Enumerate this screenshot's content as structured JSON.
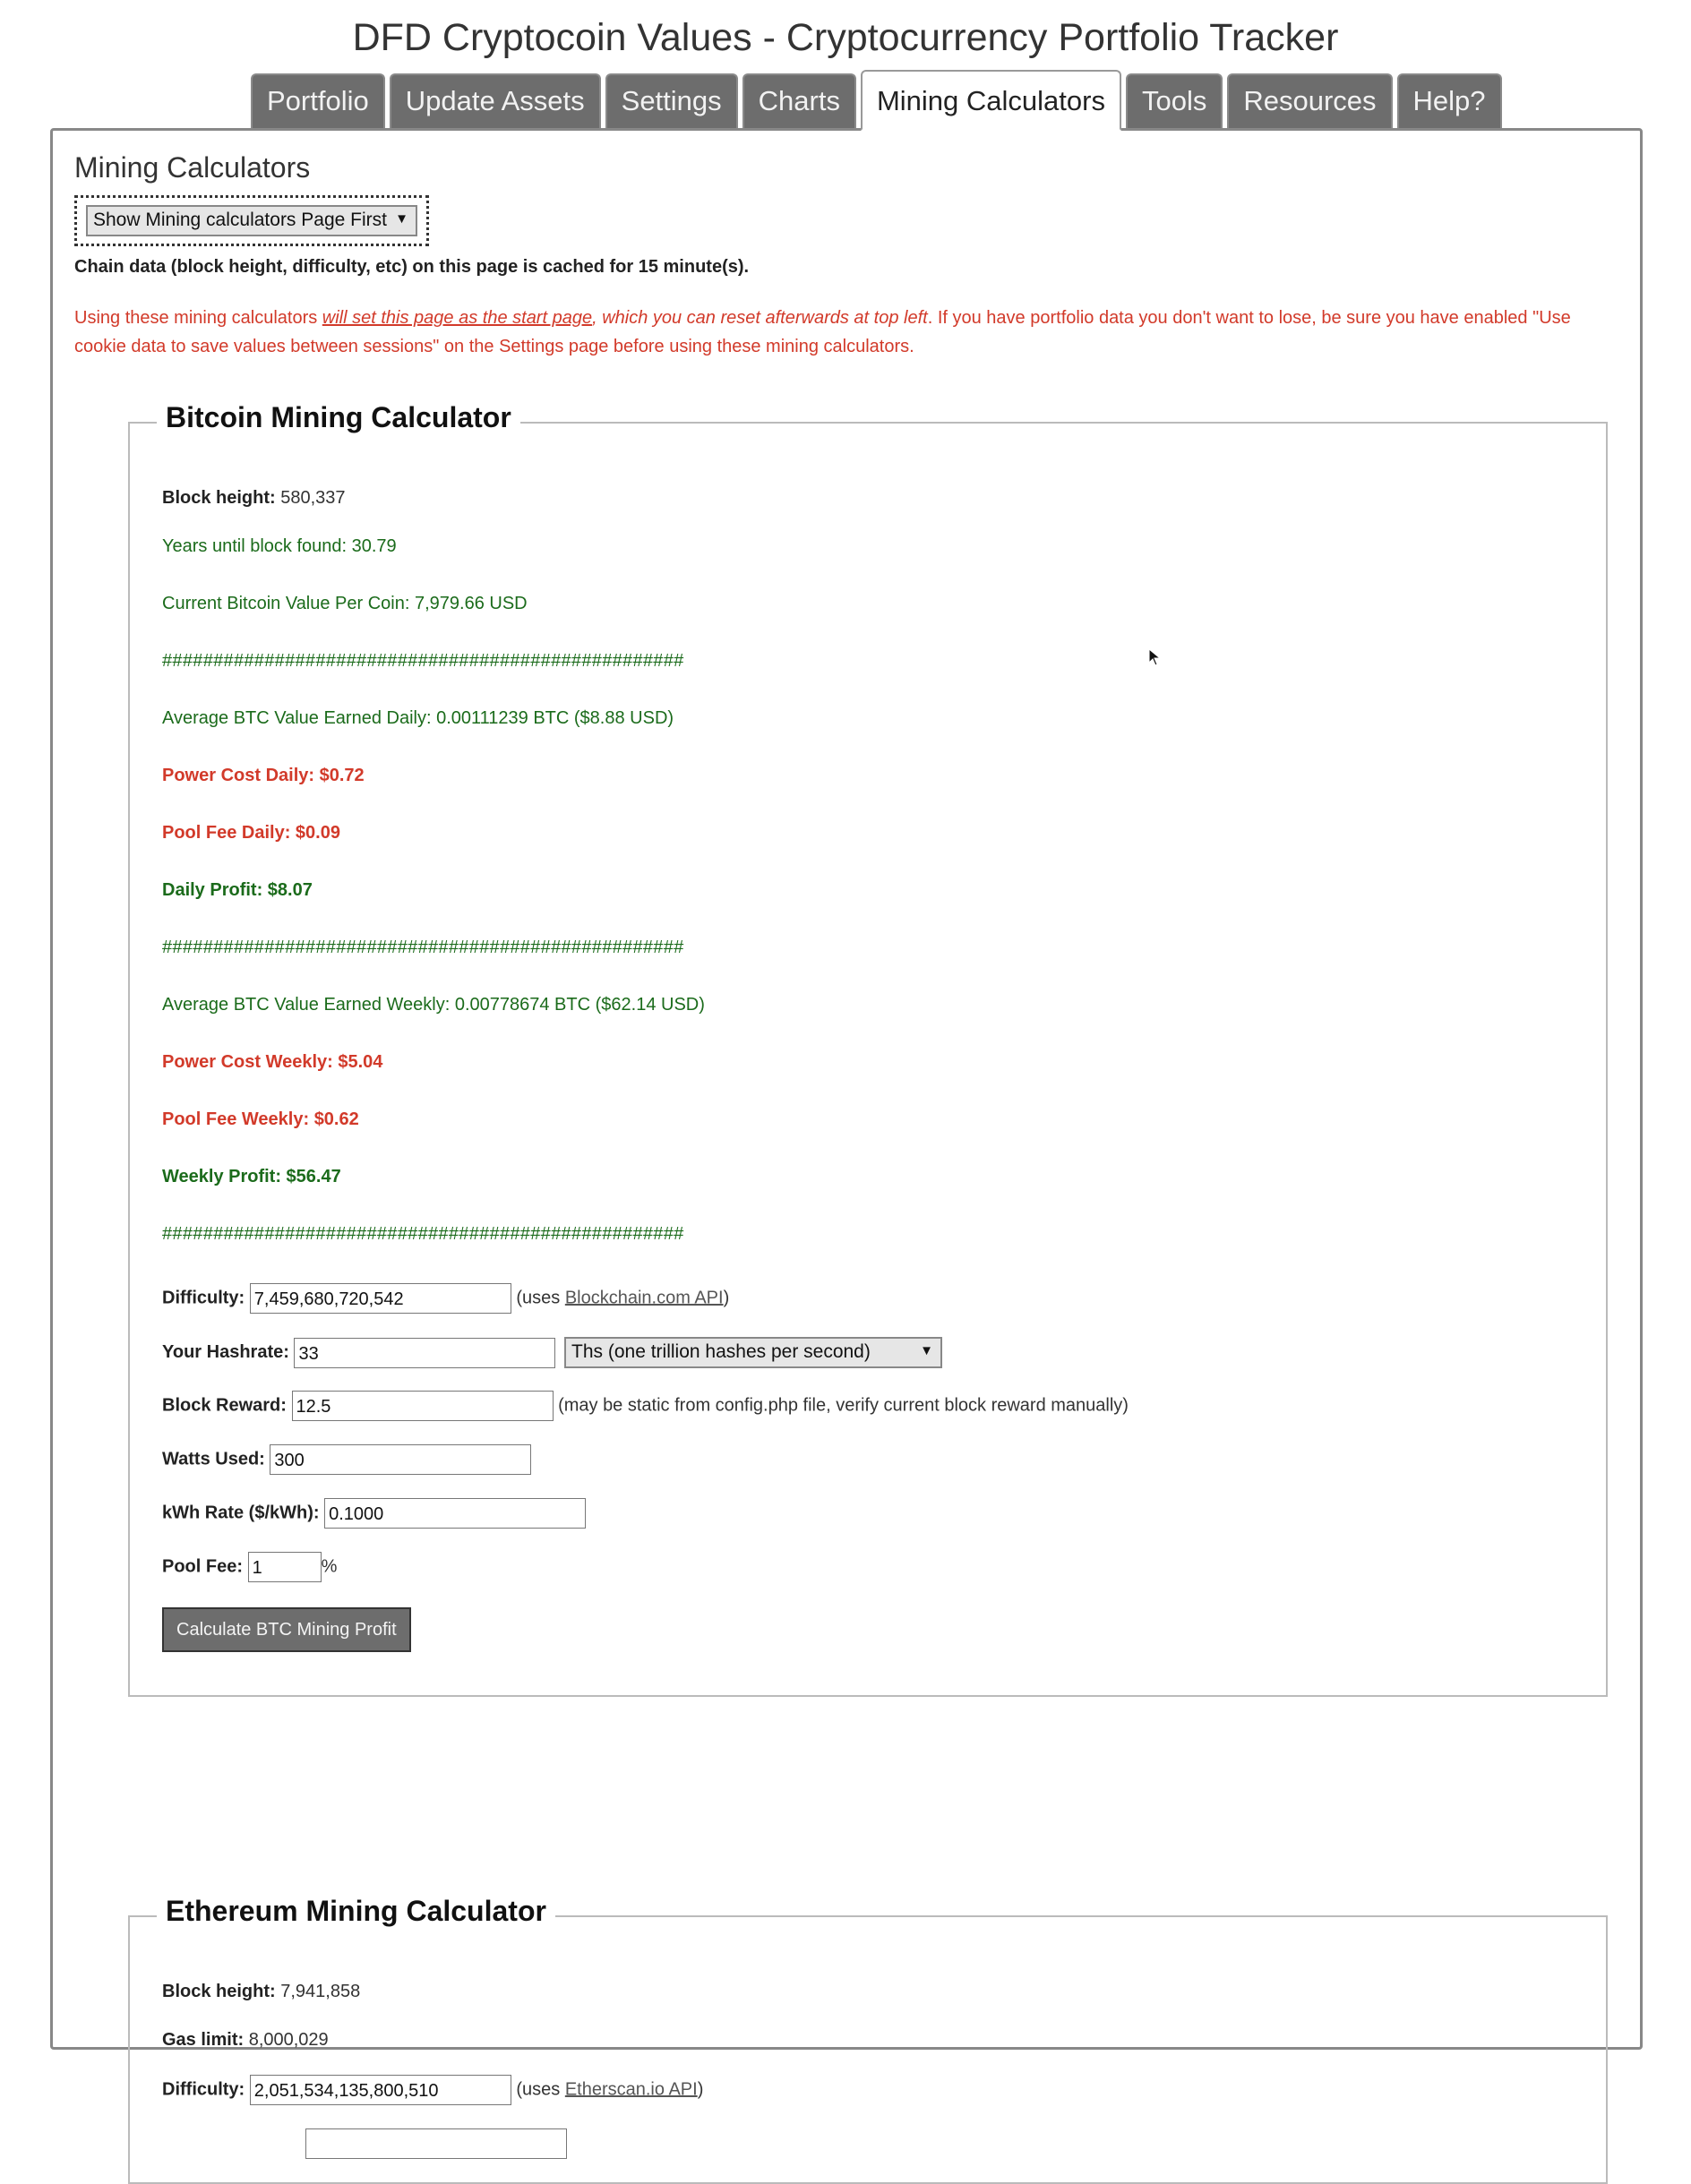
{
  "page": {
    "title": "DFD Cryptocoin Values - Cryptocurrency Portfolio Tracker"
  },
  "tabs": [
    {
      "label": "Portfolio",
      "active": false
    },
    {
      "label": "Update Assets",
      "active": false
    },
    {
      "label": "Settings",
      "active": false
    },
    {
      "label": "Charts",
      "active": false
    },
    {
      "label": "Mining Calculators",
      "active": true
    },
    {
      "label": "Tools",
      "active": false
    },
    {
      "label": "Resources",
      "active": false
    },
    {
      "label": "Help?",
      "active": false
    }
  ],
  "main": {
    "heading": "Mining Calculators",
    "start_page_select": "Show Mining calculators Page First",
    "cache_note": "Chain data (block height, difficulty, etc) on this page is cached for 15 minute(s).",
    "warning": {
      "part1": "Using these mining calculators ",
      "emph": "will set this page as the start page",
      "part2": ", which you can reset afterwards at top left",
      "part3": ". If you have portfolio data you don't want to lose, be sure you have enabled \"Use cookie data to save values between sessions\" on the Settings page before using these mining calculators."
    }
  },
  "btc": {
    "title": "Bitcoin Mining Calculator",
    "block_height_label": "Block height:",
    "block_height": "580,337",
    "years_until": "Years until block found: 30.79",
    "coin_value": "Current Bitcoin Value Per Coin: 7,979.66 USD",
    "separator": "###################################################",
    "daily_earned": "Average BTC Value Earned Daily: 0.00111239 BTC ($8.88 USD)",
    "power_daily": "Power Cost Daily: $0.72",
    "pool_daily": "Pool Fee Daily: $0.09",
    "profit_daily": "Daily Profit: $8.07",
    "weekly_earned": "Average BTC Value Earned Weekly: 0.00778674 BTC ($62.14 USD)",
    "power_weekly": "Power Cost Weekly: $5.04",
    "pool_weekly": "Pool Fee Weekly: $0.62",
    "profit_weekly": "Weekly Profit: $56.47",
    "difficulty_label": "Difficulty:",
    "difficulty": "7,459,680,720,542",
    "uses_prefix": "(uses ",
    "api_link": "Blockchain.com API",
    "uses_suffix": ")",
    "hashrate_label": "Your Hashrate:",
    "hashrate": "33",
    "hashrate_unit": "Ths (one trillion hashes per second)",
    "reward_label": "Block Reward:",
    "reward": "12.5",
    "reward_note": "(may be static from config.php file, verify current block reward manually)",
    "watts_label": "Watts Used:",
    "watts": "300",
    "kwh_label": "kWh Rate ($/kWh):",
    "kwh": "0.1000",
    "pool_fee_label": "Pool Fee:",
    "pool_fee": "1",
    "pool_fee_unit": "%",
    "calc_button": "Calculate BTC Mining Profit"
  },
  "eth": {
    "title": "Ethereum Mining Calculator",
    "block_height_label": "Block height:",
    "block_height": "7,941,858",
    "gas_limit_label": "Gas limit:",
    "gas_limit": "8,000,029",
    "difficulty_label": "Difficulty:",
    "difficulty": "2,051,534,135,800,510",
    "uses_prefix": "(uses ",
    "api_link": "Etherscan.io API",
    "uses_suffix": ")"
  }
}
